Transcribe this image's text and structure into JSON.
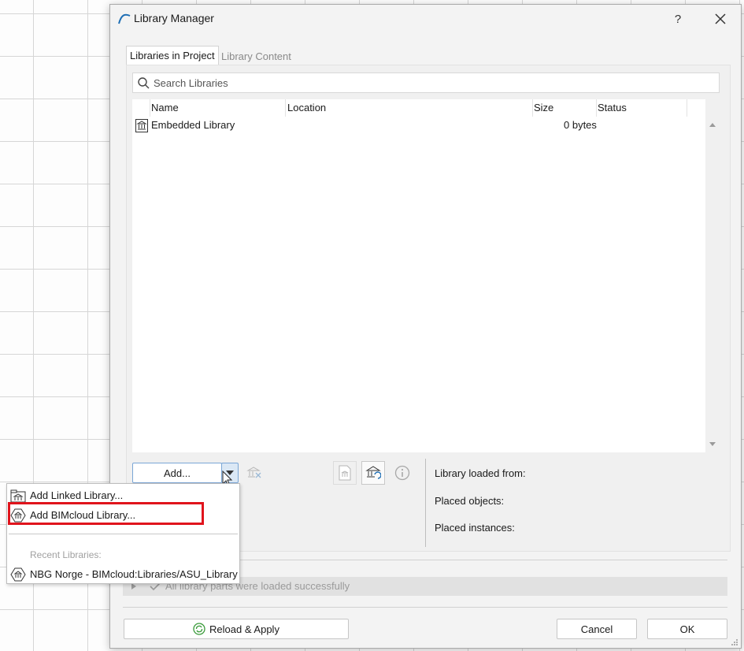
{
  "window": {
    "title": "Library Manager",
    "help_label": "?",
    "close_label": "✕"
  },
  "tabs": [
    {
      "label": "Libraries in Project",
      "active": true
    },
    {
      "label": "Library Content",
      "active": false
    }
  ],
  "search": {
    "placeholder": "Search Libraries"
  },
  "table": {
    "columns": [
      "Name",
      "Location",
      "Size",
      "Status"
    ],
    "rows": [
      {
        "name": "Embedded Library",
        "location": "",
        "size": "0 bytes",
        "status": ""
      }
    ]
  },
  "toolbar": {
    "add_label": "Add...",
    "dropdown_arrow": "▾"
  },
  "info": {
    "loaded_from_label": "Library loaded from:",
    "placed_objects_label": "Placed objects:",
    "placed_instances_label": "Placed instances:"
  },
  "status": {
    "message": "All library parts were loaded successfully"
  },
  "footer": {
    "reload_label": "Reload & Apply",
    "cancel_label": "Cancel",
    "ok_label": "OK"
  },
  "add_menu": {
    "items": [
      {
        "label": "Add Linked Library...",
        "icon": "library-linked-icon"
      },
      {
        "label": "Add BIMcloud Library...",
        "icon": "bimcloud-library-icon",
        "highlighted": true
      }
    ],
    "recent_header": "Recent Libraries:",
    "recent": [
      {
        "label": "NBG Norge - BIMcloud:Libraries/ASU_Library",
        "icon": "bimcloud-library-icon"
      }
    ]
  },
  "colors": {
    "highlight_border": "#e0141c",
    "accent_green": "#3a9b3a"
  }
}
